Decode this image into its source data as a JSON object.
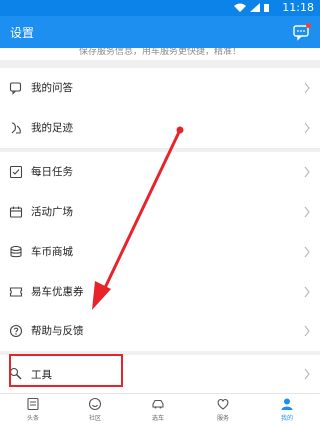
{
  "status_bar": {
    "time": "11:18"
  },
  "app_bar": {
    "title": "设置",
    "message_icon": "chat-bubble-icon"
  },
  "notice_text": "保存服务信息，用车服务更快捷，精准！",
  "menu": {
    "my_questions": "我的问答",
    "my_footprint": "我的足迹",
    "daily_tasks": "每日任务",
    "event_square": "活动广场",
    "coin_mall": "车币商城",
    "coupons": "易车优惠券",
    "help_feedback": "帮助与反馈",
    "tools": "工具"
  },
  "tabs": {
    "headlines": "头条",
    "community": "社区",
    "car_select": "选车",
    "service": "服务",
    "mine": "我的"
  },
  "colors": {
    "accent": "#1c8ff0",
    "annotation": "#e8232a"
  }
}
